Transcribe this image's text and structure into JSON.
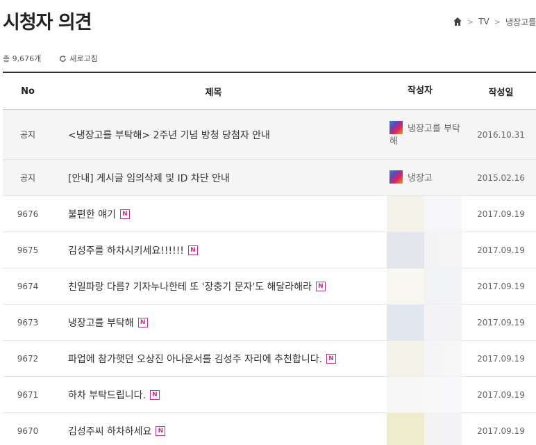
{
  "page": {
    "title": "시청자 의견"
  },
  "breadcrumb": {
    "items": [
      "TV",
      "냉장고를"
    ]
  },
  "meta": {
    "total": "총 9,676개",
    "refresh": "새로고침"
  },
  "table": {
    "headers": {
      "no": "No",
      "title": "제목",
      "author": "작성자",
      "date": "작성일"
    },
    "notices": [
      {
        "no": "공지",
        "title": "<냉장고를 부탁해> 2주년 기념 방청 당첨자 안내",
        "author": "냉장고를 부탁해",
        "date": "2016.10.31"
      },
      {
        "no": "공지",
        "title": "[안내] 게시글 임의삭제 및 ID 차단 안내",
        "author": "냉장고",
        "date": "2015.02.16"
      }
    ],
    "rows": [
      {
        "no": "9676",
        "title": "불편한 얘기",
        "badge": "N",
        "date": "2017.09.19",
        "blur": [
          "#f4f0e6",
          "#f5f5f7"
        ]
      },
      {
        "no": "9675",
        "title": "김성주를 하차시키세요!!!!!!",
        "badge": "N",
        "date": "2017.09.19",
        "blur": [
          "#dfe2ea",
          "#f3f3f5"
        ]
      },
      {
        "no": "9674",
        "title": "친일파랑 다름? 기자누나한테 또 '장충기 문자'도 해달라해라",
        "badge": "N",
        "date": "2017.09.19",
        "blur": [
          "#f7f5ef",
          "#f0f1f4"
        ]
      },
      {
        "no": "9673",
        "title": "냉장고를 부탁해",
        "badge": "N",
        "date": "2017.09.19",
        "blur": [
          "#dde2ec",
          "#f2f2f4"
        ]
      },
      {
        "no": "9672",
        "title": "파업에 참가햇던 오상진 아나운서를 김성주 자리에 추천합니다.",
        "badge": "N",
        "date": "2017.09.19",
        "blur": [
          "#f3f0e4",
          "#f4f4f6"
        ]
      },
      {
        "no": "9671",
        "title": "하차 부탁드립니다.",
        "badge": "N",
        "date": "2017.09.19",
        "blur": [
          "#f6f6f6",
          "#f7f7f9"
        ]
      },
      {
        "no": "9670",
        "title": "김성주씨 하차하세요",
        "badge": "N",
        "date": "2017.09.19",
        "blur": [
          "#ece8c6",
          "#f1f1f3"
        ]
      }
    ]
  },
  "colors": {
    "badge": "#c5318a",
    "header_rule": "#333333",
    "notice_bg": "#f5f5f5"
  }
}
